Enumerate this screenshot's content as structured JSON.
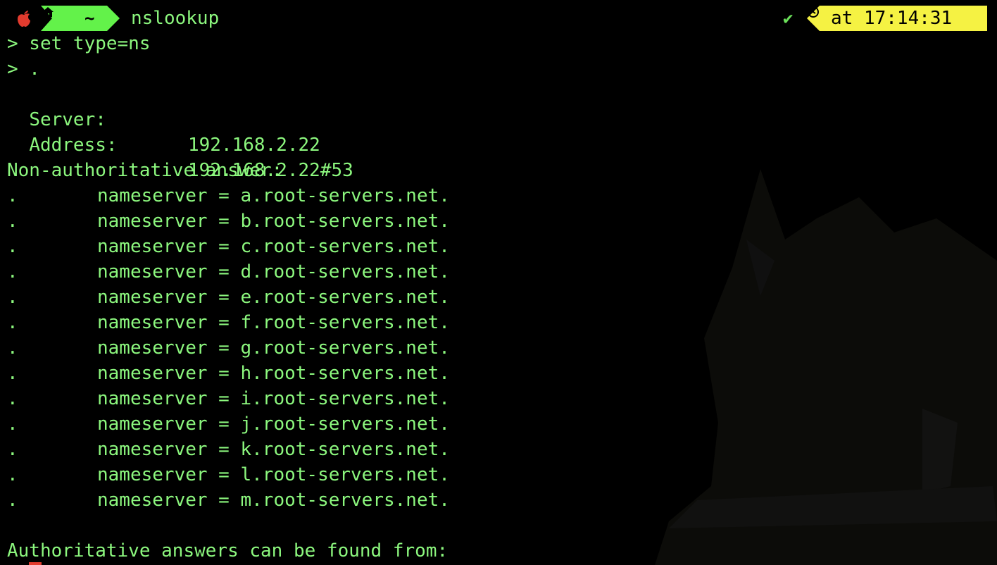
{
  "prompt": {
    "directory": "~",
    "command": "nslookup",
    "status_glyph": "✔",
    "time_prefix": "at",
    "time": "17:14:31",
    "colors": {
      "green_text": "#8cf77e",
      "home_segment": "#63f24a",
      "time_segment": "#f5f243",
      "apple": "#e23b2e"
    }
  },
  "session": {
    "input1": "> set type=ns",
    "input2": "> .",
    "server_label": "Server:",
    "server_value": "192.168.2.22",
    "address_label": "Address:",
    "address_value": "192.168.2.22#53",
    "non_auth_heading": "Non-authoritative answer:",
    "records": [
      {
        "dot": ".",
        "text": "nameserver = a.root-servers.net."
      },
      {
        "dot": ".",
        "text": "nameserver = b.root-servers.net."
      },
      {
        "dot": ".",
        "text": "nameserver = c.root-servers.net."
      },
      {
        "dot": ".",
        "text": "nameserver = d.root-servers.net."
      },
      {
        "dot": ".",
        "text": "nameserver = e.root-servers.net."
      },
      {
        "dot": ".",
        "text": "nameserver = f.root-servers.net."
      },
      {
        "dot": ".",
        "text": "nameserver = g.root-servers.net."
      },
      {
        "dot": ".",
        "text": "nameserver = h.root-servers.net."
      },
      {
        "dot": ".",
        "text": "nameserver = i.root-servers.net."
      },
      {
        "dot": ".",
        "text": "nameserver = j.root-servers.net."
      },
      {
        "dot": ".",
        "text": "nameserver = k.root-servers.net."
      },
      {
        "dot": ".",
        "text": "nameserver = l.root-servers.net."
      },
      {
        "dot": ".",
        "text": "nameserver = m.root-servers.net."
      }
    ],
    "auth_heading": "Authoritative answers can be found from:"
  },
  "icons": {
    "apple": "apple-logo-icon",
    "home": "home-icon",
    "status": "checkmark-icon",
    "clock": "clock-icon"
  }
}
